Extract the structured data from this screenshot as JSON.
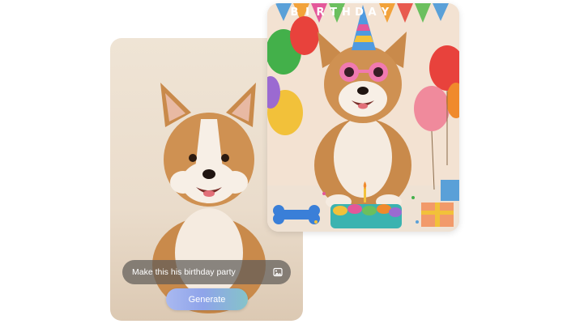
{
  "original_card": {
    "photo_subject": "corgi-portrait",
    "prompt": {
      "text": "Make this his birthday party",
      "attach_icon": "image-icon"
    },
    "generate_button": {
      "label": "Generate"
    }
  },
  "result_card": {
    "photo_subject": "corgi-birthday-party",
    "banner_letters": [
      "B",
      "I",
      "R",
      "T",
      "H",
      "D",
      "A",
      "Y"
    ]
  },
  "colors": {
    "prompt_bar": "#5f5c58",
    "generate_gradient_start": "#a9b9f0",
    "generate_gradient_end": "#85c3c9",
    "corgi_fur": "#c98a4b",
    "corgi_white": "#f7efe6"
  }
}
